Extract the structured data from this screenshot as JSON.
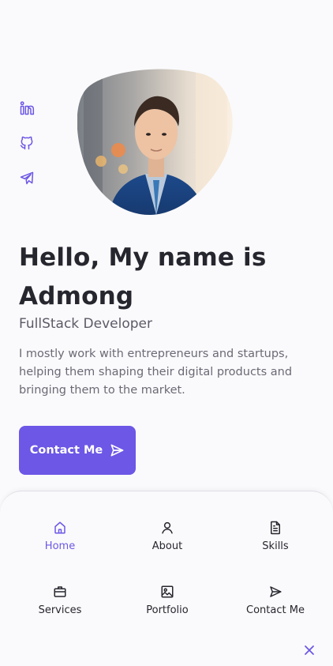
{
  "colors": {
    "accent": "#6c57e6",
    "background": "#fafafc",
    "text": "#26262e",
    "muted": "#6b6a75"
  },
  "social": [
    {
      "icon": "linkedin-icon"
    },
    {
      "icon": "github-icon"
    },
    {
      "icon": "telegram-icon"
    }
  ],
  "avatar": {
    "icon": "profile-photo"
  },
  "hero": {
    "title_line1": "Hello, My name is",
    "title_line2": "Admong",
    "subtitle": "FullStack Developer",
    "description": "I mostly work with entrepreneurs and startups, helping them shaping their digital products and bringing them to the market.",
    "button_label": "Contact Me",
    "button_icon": "send-icon"
  },
  "nav": {
    "items": [
      {
        "label": "Home",
        "icon": "home-icon",
        "active": true
      },
      {
        "label": "About",
        "icon": "user-icon",
        "active": false
      },
      {
        "label": "Skills",
        "icon": "file-icon",
        "active": false
      },
      {
        "label": "Services",
        "icon": "briefcase-icon",
        "active": false
      },
      {
        "label": "Portfolio",
        "icon": "image-icon",
        "active": false
      },
      {
        "label": "Contact Me",
        "icon": "send-icon",
        "active": false
      }
    ],
    "close_icon": "close-icon"
  }
}
